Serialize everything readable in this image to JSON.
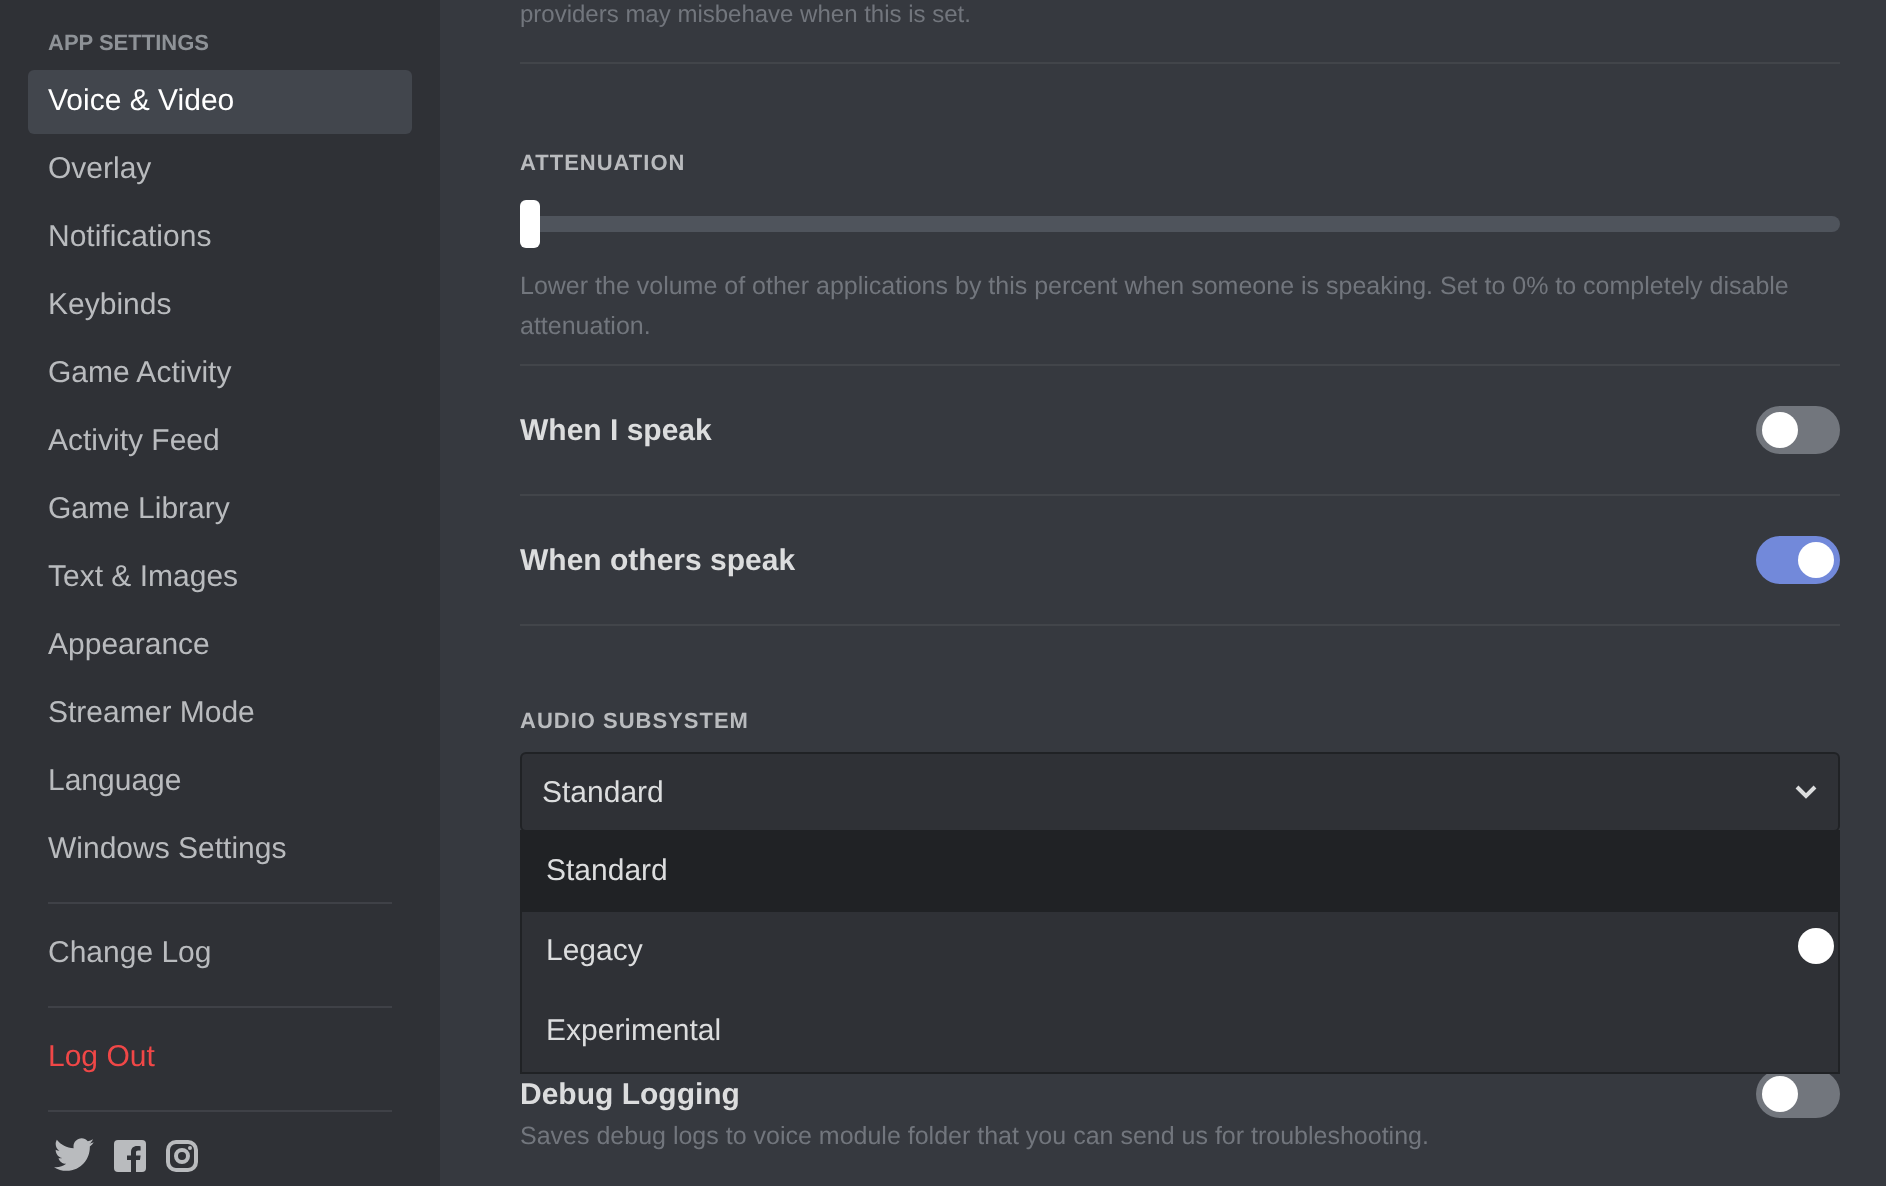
{
  "sidebar": {
    "heading": "APP SETTINGS",
    "items": [
      {
        "label": "Voice & Video",
        "selected": true
      },
      {
        "label": "Overlay",
        "selected": false
      },
      {
        "label": "Notifications",
        "selected": false
      },
      {
        "label": "Keybinds",
        "selected": false
      },
      {
        "label": "Game Activity",
        "selected": false
      },
      {
        "label": "Activity Feed",
        "selected": false
      },
      {
        "label": "Game Library",
        "selected": false
      },
      {
        "label": "Text & Images",
        "selected": false
      },
      {
        "label": "Appearance",
        "selected": false
      },
      {
        "label": "Streamer Mode",
        "selected": false
      },
      {
        "label": "Language",
        "selected": false
      },
      {
        "label": "Windows Settings",
        "selected": false
      }
    ],
    "change_log": "Change Log",
    "log_out": "Log Out"
  },
  "top_note": "providers may misbehave when this is set.",
  "attenuation": {
    "label": "ATTENUATION",
    "level": 0,
    "description": "Lower the volume of other applications by this percent when someone is speaking. Set to 0% to completely disable attenuation."
  },
  "toggles": [
    {
      "label": "When I speak",
      "on": false
    },
    {
      "label": "When others speak",
      "on": true
    }
  ],
  "audio_subsystem": {
    "label": "AUDIO SUBSYSTEM",
    "value": "Standard",
    "options": [
      {
        "label": "Standard",
        "selected": true
      },
      {
        "label": "Legacy",
        "selected": false
      },
      {
        "label": "Experimental",
        "selected": false
      }
    ]
  },
  "debug_logging": {
    "label": "Debug Logging",
    "on": false,
    "description": "Saves debug logs to voice module folder that you can send us for troubleshooting."
  }
}
